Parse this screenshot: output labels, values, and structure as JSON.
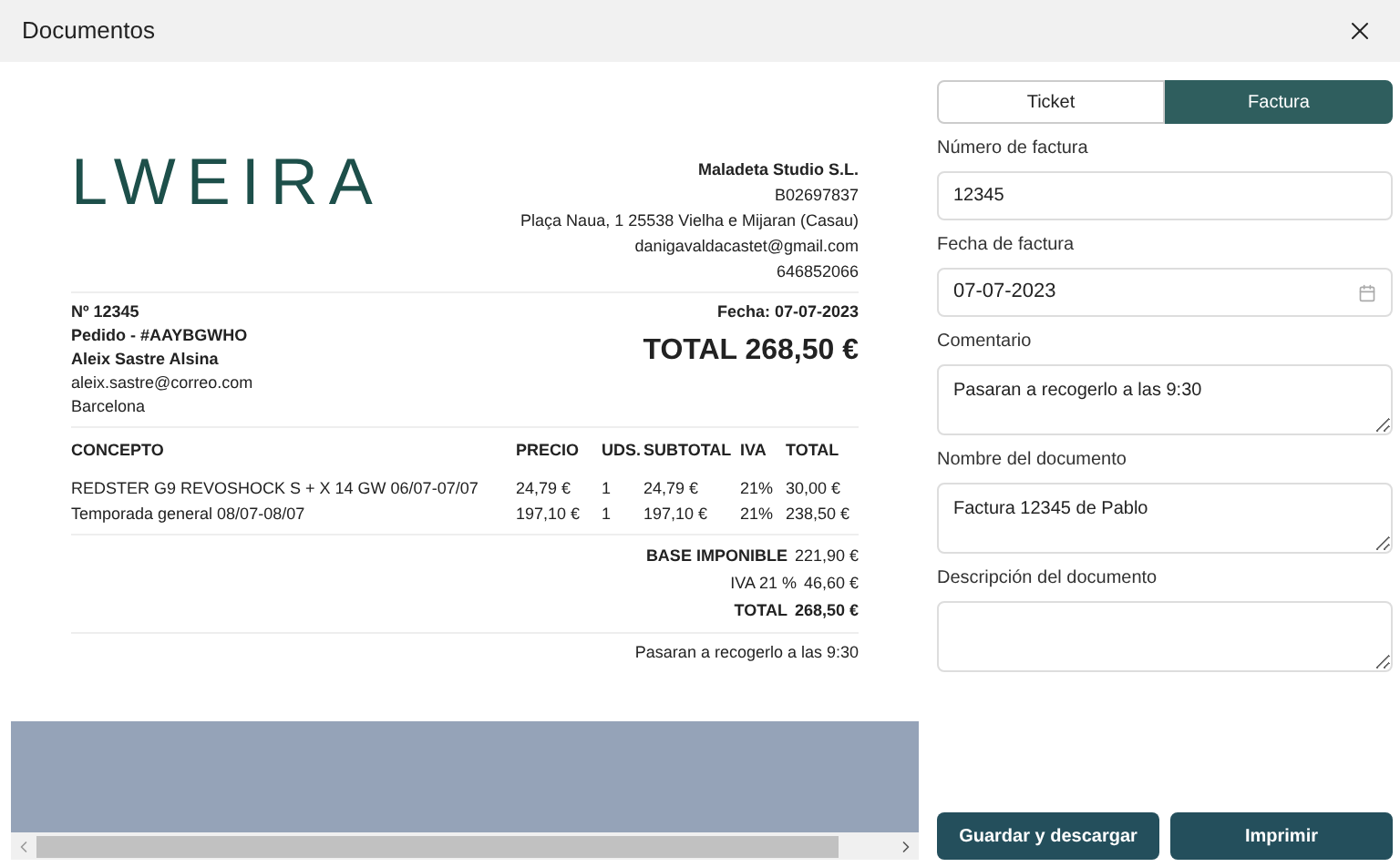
{
  "window": {
    "title": "Documentos"
  },
  "invoice": {
    "logo": "LWEIRA",
    "company": [
      "Maladeta Studio S.L.",
      "B02697837",
      "Plaça Naua, 1 25538 Vielha e Mijaran (Casau)",
      "danigavaldacastet@gmail.com",
      "646852066"
    ],
    "customer": [
      "Nº 12345",
      "Pedido - #AAYBGWHO",
      "Aleix Sastre Alsina",
      "aleix.sastre@correo.com",
      "Barcelona"
    ],
    "date": "Fecha: 07-07-2023",
    "total": "TOTAL 268,50 €",
    "table": {
      "columns": [
        "CONCEPTO",
        "PRECIO",
        "UDS.",
        "SUBTOTAL",
        "IVA",
        "TOTAL"
      ],
      "rows": [
        [
          "REDSTER G9 REVOSHOCK S + X 14 GW 06/07-07/07",
          "24,79 €",
          "1",
          "24,79 €",
          "21%",
          "30,00 €"
        ],
        [
          "Temporada general 08/07-08/07",
          "197,10 €",
          "1",
          "197,10 €",
          "21%",
          "238,50 €"
        ]
      ]
    },
    "summary": [
      {
        "label": "BASE IMPONIBLE",
        "value": "221,90 €"
      },
      {
        "label": "IVA 21 %",
        "value": "46,60 €"
      },
      {
        "label": "TOTAL",
        "value": "268,50 €"
      }
    ],
    "comment": "Pasaran a recogerlo a las 9:30"
  },
  "tabs": [
    {
      "label": "Ticket",
      "selected": false
    },
    {
      "label": "Factura",
      "selected": true
    }
  ],
  "form": [
    {
      "label": "Número de factura",
      "kind": "text",
      "value": "12345"
    },
    {
      "label": "Fecha de factura",
      "kind": "date",
      "value": "07-07-2023"
    },
    {
      "label": "Comentario",
      "kind": "textarea",
      "value": "Pasaran a recogerlo a las 9:30"
    },
    {
      "label": "Nombre del documento",
      "kind": "textarea",
      "value": "Factura 12345 de Pablo"
    },
    {
      "label": "Descripción del documento",
      "kind": "textarea"
    }
  ],
  "buttons": [
    "Guardar y descargar",
    "Imprimir"
  ]
}
